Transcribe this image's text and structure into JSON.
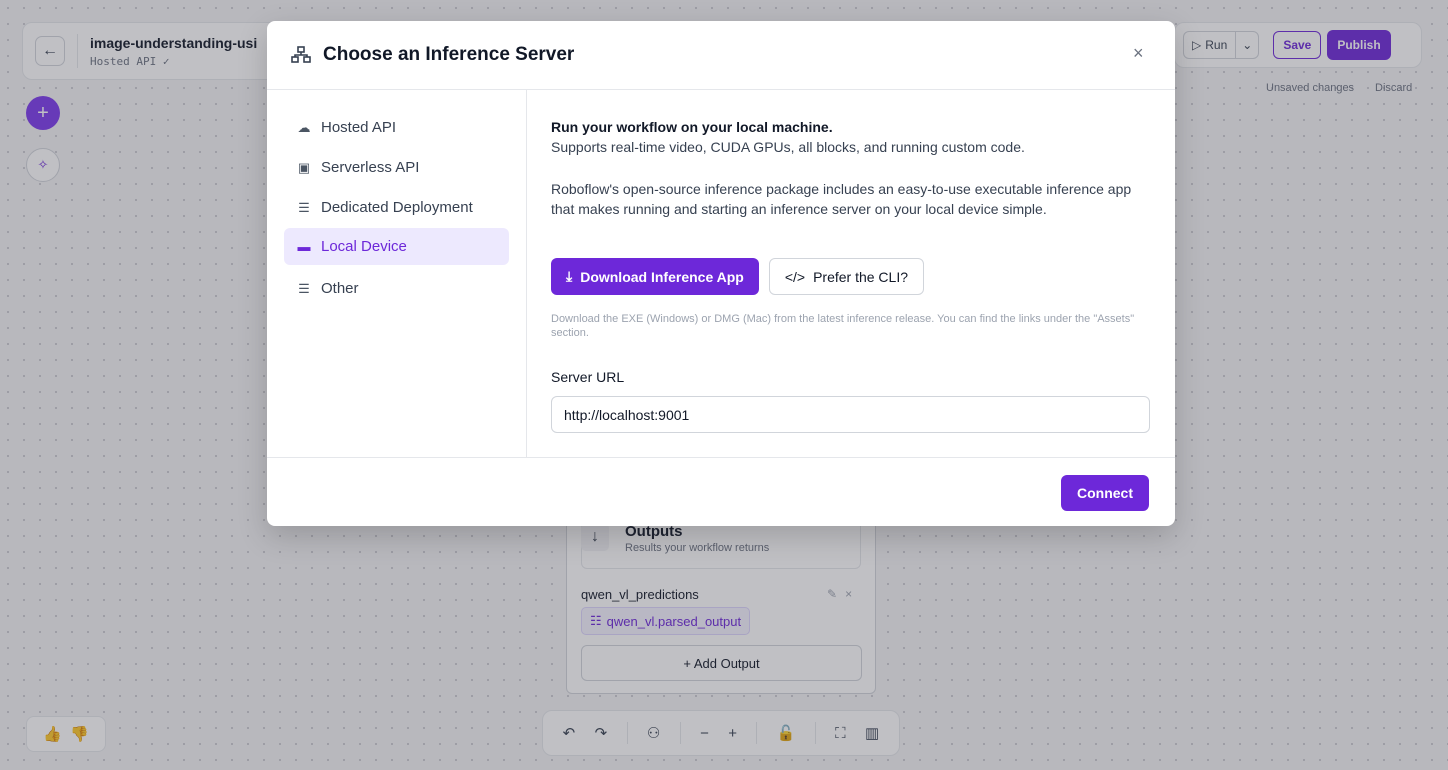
{
  "workflow": {
    "title": "image-understanding-usi",
    "server_status": "Hosted API ✓"
  },
  "toolbar": {
    "run_label": "Run",
    "save_label": "Save",
    "publish_label": "Publish",
    "unsaved_text": "Unsaved changes",
    "discard_label": "Discard"
  },
  "outputs_node": {
    "title": "Outputs",
    "description": "Results your workflow returns",
    "output_name": "qwen_vl_predictions",
    "output_value": "qwen_vl.parsed_output",
    "add_output_label": "+ Add Output"
  },
  "modal": {
    "title": "Choose an Inference Server",
    "close_label": "×",
    "sidebar": [
      {
        "label": "Hosted API",
        "icon": "cloud-upload-icon",
        "active": false
      },
      {
        "label": "Serverless API",
        "icon": "chip-icon",
        "active": false
      },
      {
        "label": "Dedicated Deployment",
        "icon": "server-icon",
        "active": false
      },
      {
        "label": "Local Device",
        "icon": "laptop-icon",
        "active": true
      },
      {
        "label": "Other",
        "icon": "server-icon",
        "active": false
      }
    ],
    "content": {
      "headline": "Run your workflow on your local machine.",
      "subline": "Supports real-time video, CUDA GPUs, all blocks, and running custom code.",
      "paragraph": "Roboflow's open-source inference package includes an easy-to-use executable inference app that makes running and starting an inference server on your local device simple.",
      "download_label": "Download Inference App",
      "cli_label": "Prefer the CLI?",
      "hint": "Download the EXE (Windows) or DMG (Mac) from the latest inference release. You can find the links under the \"Assets\" section.",
      "url_label": "Server URL",
      "url_value": "http://localhost:9001"
    },
    "connect_label": "Connect"
  },
  "colors": {
    "accent": "#6d28d9",
    "accent_light": "#ede9fe"
  }
}
